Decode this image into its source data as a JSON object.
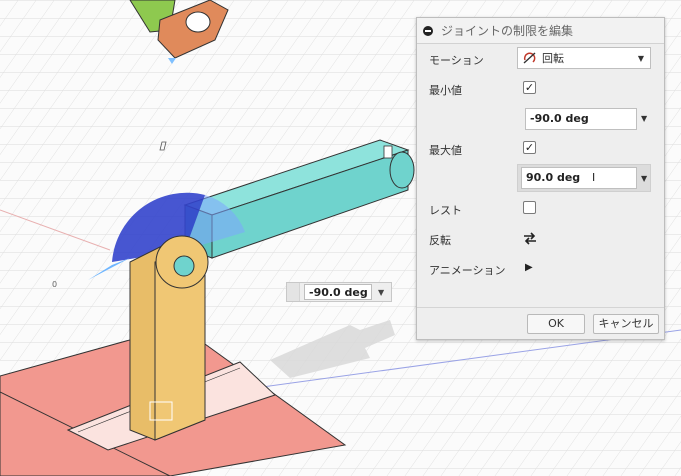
{
  "dialog": {
    "title": "ジョイントの制限を編集",
    "motion": {
      "label": "モーション",
      "value": "回転"
    },
    "min": {
      "label": "最小値",
      "checked": true,
      "value": "-90.0 deg"
    },
    "max": {
      "label": "最大値",
      "checked": true,
      "value": "90.0 deg"
    },
    "rest": {
      "label": "レスト",
      "checked": false
    },
    "reverse": {
      "label": "反転"
    },
    "animation": {
      "label": "アニメーション"
    },
    "ok_label": "OK",
    "cancel_label": "キャンセル"
  },
  "viewport": {
    "angle_value": "-90.0 deg",
    "small_label": "0"
  },
  "colors": {
    "arm": "#6fd3cd",
    "link": "#e8bd68",
    "base": "#f2988f",
    "sweep": "#3344cc",
    "gear_orange": "#e08a5b",
    "gear_green": "#8ec94f"
  }
}
